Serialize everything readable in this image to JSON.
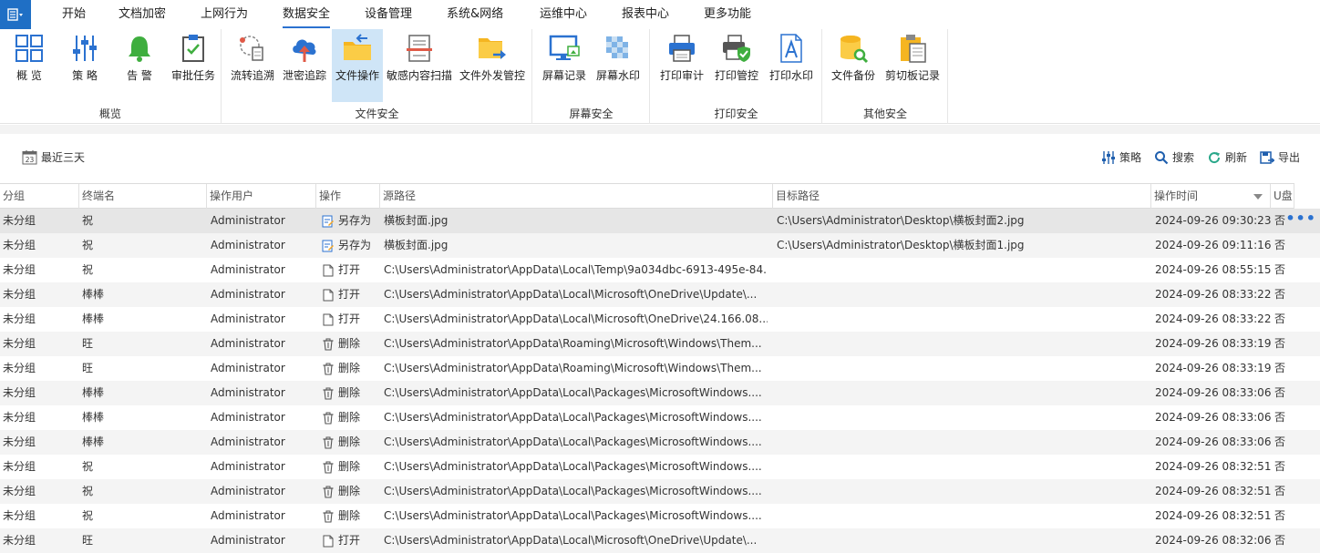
{
  "menu": {
    "items": [
      "开始",
      "文档加密",
      "上网行为",
      "数据安全",
      "设备管理",
      "系统&网络",
      "运维中心",
      "报表中心",
      "更多功能"
    ],
    "active_index": 3
  },
  "ribbon": {
    "groups": [
      {
        "label": "概览",
        "buttons": [
          {
            "label": "概 览",
            "icon": "dashboard-icon"
          },
          {
            "label": "策 略",
            "icon": "sliders-icon"
          },
          {
            "label": "告 警",
            "icon": "bell-icon"
          },
          {
            "label": "审批任务",
            "icon": "clipboard-check-icon"
          }
        ]
      },
      {
        "label": "文件安全",
        "buttons": [
          {
            "label": "流转追溯",
            "icon": "trace-icon"
          },
          {
            "label": "泄密追踪",
            "icon": "cloud-upload-icon"
          },
          {
            "label": "文件操作",
            "icon": "folder-action-icon",
            "selected": true
          },
          {
            "label": "敏感内容扫描",
            "icon": "document-scan-icon"
          },
          {
            "label": "文件外发管控",
            "icon": "folder-send-icon"
          }
        ]
      },
      {
        "label": "屏幕安全",
        "buttons": [
          {
            "label": "屏幕记录",
            "icon": "screen-record-icon"
          },
          {
            "label": "屏幕水印",
            "icon": "watermark-icon"
          }
        ]
      },
      {
        "label": "打印安全",
        "buttons": [
          {
            "label": "打印审计",
            "icon": "printer-icon"
          },
          {
            "label": "打印管控",
            "icon": "printer-shield-icon"
          },
          {
            "label": "打印水印",
            "icon": "text-a-icon"
          }
        ]
      },
      {
        "label": "其他安全",
        "buttons": [
          {
            "label": "文件备份",
            "icon": "database-search-icon"
          },
          {
            "label": "剪切板记录",
            "icon": "clipboard-icon"
          }
        ]
      }
    ]
  },
  "toolbar": {
    "date_label": "最近三天",
    "calendar_day": "23",
    "actions": [
      {
        "label": "策略",
        "icon": "sliders-icon"
      },
      {
        "label": "搜索",
        "icon": "search-icon"
      },
      {
        "label": "刷新",
        "icon": "refresh-icon"
      },
      {
        "label": "导出",
        "icon": "export-icon"
      }
    ]
  },
  "table": {
    "columns": [
      "分组",
      "终端名",
      "操作用户",
      "操作",
      "源路径",
      "目标路径",
      "操作时间",
      "U盘"
    ],
    "sorted_column": "操作时间",
    "rows": [
      {
        "group": "未分组",
        "terminal": "祝",
        "user": "Administrator",
        "op": "另存为",
        "op_icon": "save-as-icon",
        "src": "横板封面.jpg",
        "dst": "C:\\Users\\Administrator\\Desktop\\横板封面2.jpg",
        "time": "2024-09-26 09:30:23",
        "usb": "否"
      },
      {
        "group": "未分组",
        "terminal": "祝",
        "user": "Administrator",
        "op": "另存为",
        "op_icon": "save-as-icon",
        "src": "横板封面.jpg",
        "dst": "C:\\Users\\Administrator\\Desktop\\横板封面1.jpg",
        "time": "2024-09-26 09:11:16",
        "usb": "否"
      },
      {
        "group": "未分组",
        "terminal": "祝",
        "user": "Administrator",
        "op": "打开",
        "op_icon": "file-open-icon",
        "src": "C:\\Users\\Administrator\\AppData\\Local\\Temp\\9a034dbc-6913-495e-84...",
        "dst": "",
        "time": "2024-09-26 08:55:15",
        "usb": "否"
      },
      {
        "group": "未分组",
        "terminal": "棒棒",
        "user": "Administrator",
        "op": "打开",
        "op_icon": "file-open-icon",
        "src": "C:\\Users\\Administrator\\AppData\\Local\\Microsoft\\OneDrive\\Update\\...",
        "dst": "",
        "time": "2024-09-26 08:33:22",
        "usb": "否"
      },
      {
        "group": "未分组",
        "terminal": "棒棒",
        "user": "Administrator",
        "op": "打开",
        "op_icon": "file-open-icon",
        "src": "C:\\Users\\Administrator\\AppData\\Local\\Microsoft\\OneDrive\\24.166.08...",
        "dst": "",
        "time": "2024-09-26 08:33:22",
        "usb": "否"
      },
      {
        "group": "未分组",
        "terminal": "旺",
        "user": "Administrator",
        "op": "删除",
        "op_icon": "trash-icon",
        "src": "C:\\Users\\Administrator\\AppData\\Roaming\\Microsoft\\Windows\\Them...",
        "dst": "",
        "time": "2024-09-26 08:33:19",
        "usb": "否"
      },
      {
        "group": "未分组",
        "terminal": "旺",
        "user": "Administrator",
        "op": "删除",
        "op_icon": "trash-icon",
        "src": "C:\\Users\\Administrator\\AppData\\Roaming\\Microsoft\\Windows\\Them...",
        "dst": "",
        "time": "2024-09-26 08:33:19",
        "usb": "否"
      },
      {
        "group": "未分组",
        "terminal": "棒棒",
        "user": "Administrator",
        "op": "删除",
        "op_icon": "trash-icon",
        "src": "C:\\Users\\Administrator\\AppData\\Local\\Packages\\MicrosoftWindows....",
        "dst": "",
        "time": "2024-09-26 08:33:06",
        "usb": "否"
      },
      {
        "group": "未分组",
        "terminal": "棒棒",
        "user": "Administrator",
        "op": "删除",
        "op_icon": "trash-icon",
        "src": "C:\\Users\\Administrator\\AppData\\Local\\Packages\\MicrosoftWindows....",
        "dst": "",
        "time": "2024-09-26 08:33:06",
        "usb": "否"
      },
      {
        "group": "未分组",
        "terminal": "棒棒",
        "user": "Administrator",
        "op": "删除",
        "op_icon": "trash-icon",
        "src": "C:\\Users\\Administrator\\AppData\\Local\\Packages\\MicrosoftWindows....",
        "dst": "",
        "time": "2024-09-26 08:33:06",
        "usb": "否"
      },
      {
        "group": "未分组",
        "terminal": "祝",
        "user": "Administrator",
        "op": "删除",
        "op_icon": "trash-icon",
        "src": "C:\\Users\\Administrator\\AppData\\Local\\Packages\\MicrosoftWindows....",
        "dst": "",
        "time": "2024-09-26 08:32:51",
        "usb": "否"
      },
      {
        "group": "未分组",
        "terminal": "祝",
        "user": "Administrator",
        "op": "删除",
        "op_icon": "trash-icon",
        "src": "C:\\Users\\Administrator\\AppData\\Local\\Packages\\MicrosoftWindows....",
        "dst": "",
        "time": "2024-09-26 08:32:51",
        "usb": "否"
      },
      {
        "group": "未分组",
        "terminal": "祝",
        "user": "Administrator",
        "op": "删除",
        "op_icon": "trash-icon",
        "src": "C:\\Users\\Administrator\\AppData\\Local\\Packages\\MicrosoftWindows....",
        "dst": "",
        "time": "2024-09-26 08:32:51",
        "usb": "否"
      },
      {
        "group": "未分组",
        "terminal": "旺",
        "user": "Administrator",
        "op": "打开",
        "op_icon": "file-open-icon",
        "src": "C:\\Users\\Administrator\\AppData\\Local\\Microsoft\\OneDrive\\Update\\...",
        "dst": "",
        "time": "2024-09-26 08:32:06",
        "usb": "否"
      }
    ],
    "selected_row": 0,
    "row_more": "•••"
  },
  "colors": {
    "accent": "#2b72d0",
    "selected_button": "#cfe5f7",
    "app_button": "#1f6fc5"
  }
}
